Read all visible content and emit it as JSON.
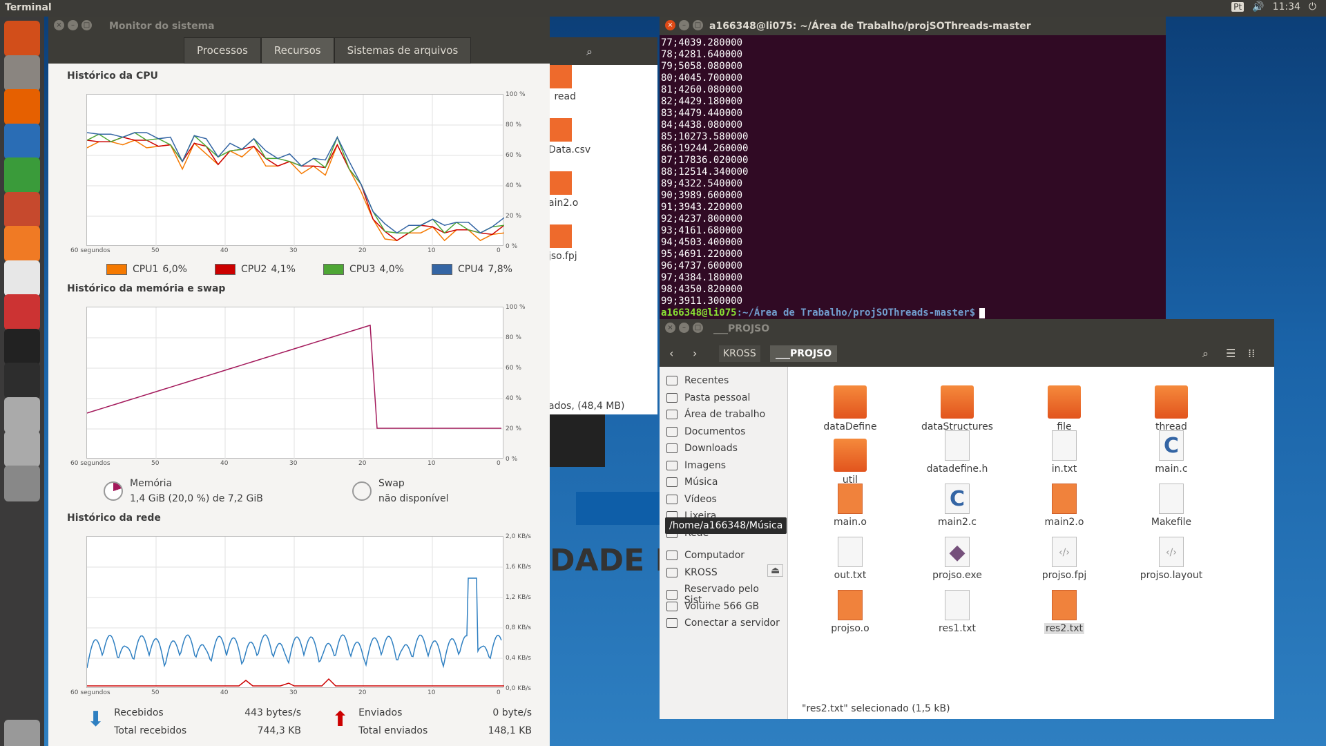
{
  "topbar": {
    "title": "Terminal",
    "lang": "Pt",
    "time": "11:34"
  },
  "launcher": [
    "ubuntu-dash-icon",
    "files-icon",
    "firefox-icon",
    "writer-icon",
    "calc-icon",
    "impress-icon",
    "software-center-icon",
    "amazon-icon",
    "settings-icon",
    "terminal-icon",
    "system-monitor-icon",
    "drive-icon",
    "drive2-icon",
    "usb-icon",
    "trash-icon"
  ],
  "monitor": {
    "title": "Monitor do sistema",
    "tabs": [
      "Processos",
      "Recursos",
      "Sistemas de arquivos"
    ],
    "cpu_title": "Histórico da CPU",
    "mem_title": "Histórico da memória e swap",
    "net_title": "Histórico da rede",
    "x_ticks": [
      "60 segundos",
      "50",
      "40",
      "30",
      "20",
      "10",
      "0"
    ],
    "pct_ticks": [
      "100 %",
      "80 %",
      "60 %",
      "40 %",
      "20 %",
      "0 %"
    ],
    "net_ticks": [
      "2,0 KB/s",
      "1,6 KB/s",
      "1,2 KB/s",
      "0,8 KB/s",
      "0,4 KB/s",
      "0,0 KB/s"
    ],
    "cpu_legend": [
      {
        "name": "CPU1",
        "value": "6,0%",
        "color": "#f57900"
      },
      {
        "name": "CPU2",
        "value": "4,1%",
        "color": "#cc0000"
      },
      {
        "name": "CPU3",
        "value": "4,0%",
        "color": "#4ea635"
      },
      {
        "name": "CPU4",
        "value": "7,8%",
        "color": "#3465a4"
      }
    ],
    "mem_label": "Memória",
    "mem_value": "1,4 GiB (20,0 %) de 7,2 GiB",
    "swap_label": "Swap",
    "swap_value": "não disponível",
    "recv_label": "Recebidos",
    "recv_value": "443 bytes/s",
    "total_recv_label": "Total recebidos",
    "total_recv_value": "744,3 KB",
    "sent_label": "Enviados",
    "sent_value": "0 byte/s",
    "total_sent_label": "Total enviados",
    "total_sent_value": "148,1 KB",
    "behind_text": "ados, (48,4 MB)",
    "behind_files": [
      "read",
      "Data.csv",
      "ain2.o",
      "jso.fpj"
    ],
    "wallpaper_text": "DADE D"
  },
  "terminal": {
    "title": "a166348@li075: ~/Área de Trabalho/projSOThreads-master",
    "lines": [
      "77;4039.280000",
      "78;4281.640000",
      "79;5058.080000",
      "80;4045.700000",
      "81;4260.080000",
      "82;4429.180000",
      "83;4479.440000",
      "84;4438.080000",
      "85;10273.580000",
      "86;19244.260000",
      "87;17836.020000",
      "88;12514.340000",
      "89;4322.540000",
      "90;3989.600000",
      "91;3943.220000",
      "92;4237.800000",
      "93;4161.680000",
      "94;4503.400000",
      "95;4691.220000",
      "96;4737.600000",
      "97;4384.180000",
      "98;4350.820000",
      "99;3911.300000"
    ],
    "prompt_user": "a166348@li075",
    "prompt_path": ":~/Área de Trabalho/projSOThreads-master$"
  },
  "files": {
    "title": "___PROJSO",
    "crumbs": [
      "KROSS",
      "___PROJSO"
    ],
    "sidebar": [
      "Recentes",
      "Pasta pessoal",
      "Área de trabalho",
      "Documentos",
      "Downloads",
      "Imagens",
      "Música",
      "Vídeos",
      "Lixeira",
      "Rede",
      "Computador",
      "KROSS",
      "Reservado pelo Sist...",
      "Volume 566 GB",
      "Conectar a servidor"
    ],
    "tooltip": "/home/a166348/Música",
    "items": [
      {
        "name": "dataDefine",
        "kind": "folder"
      },
      {
        "name": "dataStructures",
        "kind": "folder"
      },
      {
        "name": "file",
        "kind": "folder"
      },
      {
        "name": "thread",
        "kind": "folder"
      },
      {
        "name": "util",
        "kind": "folder"
      },
      {
        "name": "datadefine.h",
        "kind": "doc"
      },
      {
        "name": "in.txt",
        "kind": "doc"
      },
      {
        "name": "main.c",
        "kind": "c"
      },
      {
        "name": "main.o",
        "kind": "bin"
      },
      {
        "name": "main2.c",
        "kind": "c"
      },
      {
        "name": "main2.o",
        "kind": "bin"
      },
      {
        "name": "Makefile",
        "kind": "doc"
      },
      {
        "name": "out.txt",
        "kind": "doc"
      },
      {
        "name": "projso.exe",
        "kind": "exe"
      },
      {
        "name": "projso.fpj",
        "kind": "code"
      },
      {
        "name": "projso.layout",
        "kind": "code"
      },
      {
        "name": "projso.o",
        "kind": "bin"
      },
      {
        "name": "res1.txt",
        "kind": "doc"
      },
      {
        "name": "res2.txt",
        "kind": "sel"
      }
    ],
    "status": "\"res2.txt\" selecionado  (1,5 kB)"
  }
}
